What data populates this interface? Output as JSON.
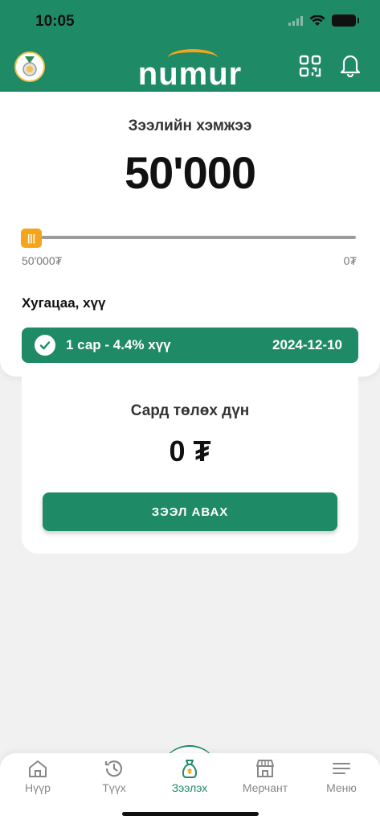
{
  "status": {
    "time": "10:05"
  },
  "header": {
    "logo_text": "numur"
  },
  "loan": {
    "amount_title": "Зээлийн хэмжээ",
    "amount": "50'000",
    "slider_thumb": "|||",
    "slider_min": "50'000₮",
    "slider_max": "0₮",
    "term_label": "Хугацаа, хүү",
    "term_option": "1 сар - 4.4% хүү",
    "term_date": "2024-12-10"
  },
  "payment": {
    "title": "Сард төлөх дүн",
    "value": "0 ₮",
    "button_label": "ЗЭЭЛ АВАХ"
  },
  "tabs": [
    {
      "label": "Нүүр",
      "icon": "home-icon"
    },
    {
      "label": "Түүх",
      "icon": "history-icon"
    },
    {
      "label": "Зээлэх",
      "icon": "money-bag-icon"
    },
    {
      "label": "Мерчант",
      "icon": "store-icon"
    },
    {
      "label": "Меню",
      "icon": "menu-icon"
    }
  ],
  "colors": {
    "brand": "#1f8a66",
    "accent": "#f4a51c"
  }
}
